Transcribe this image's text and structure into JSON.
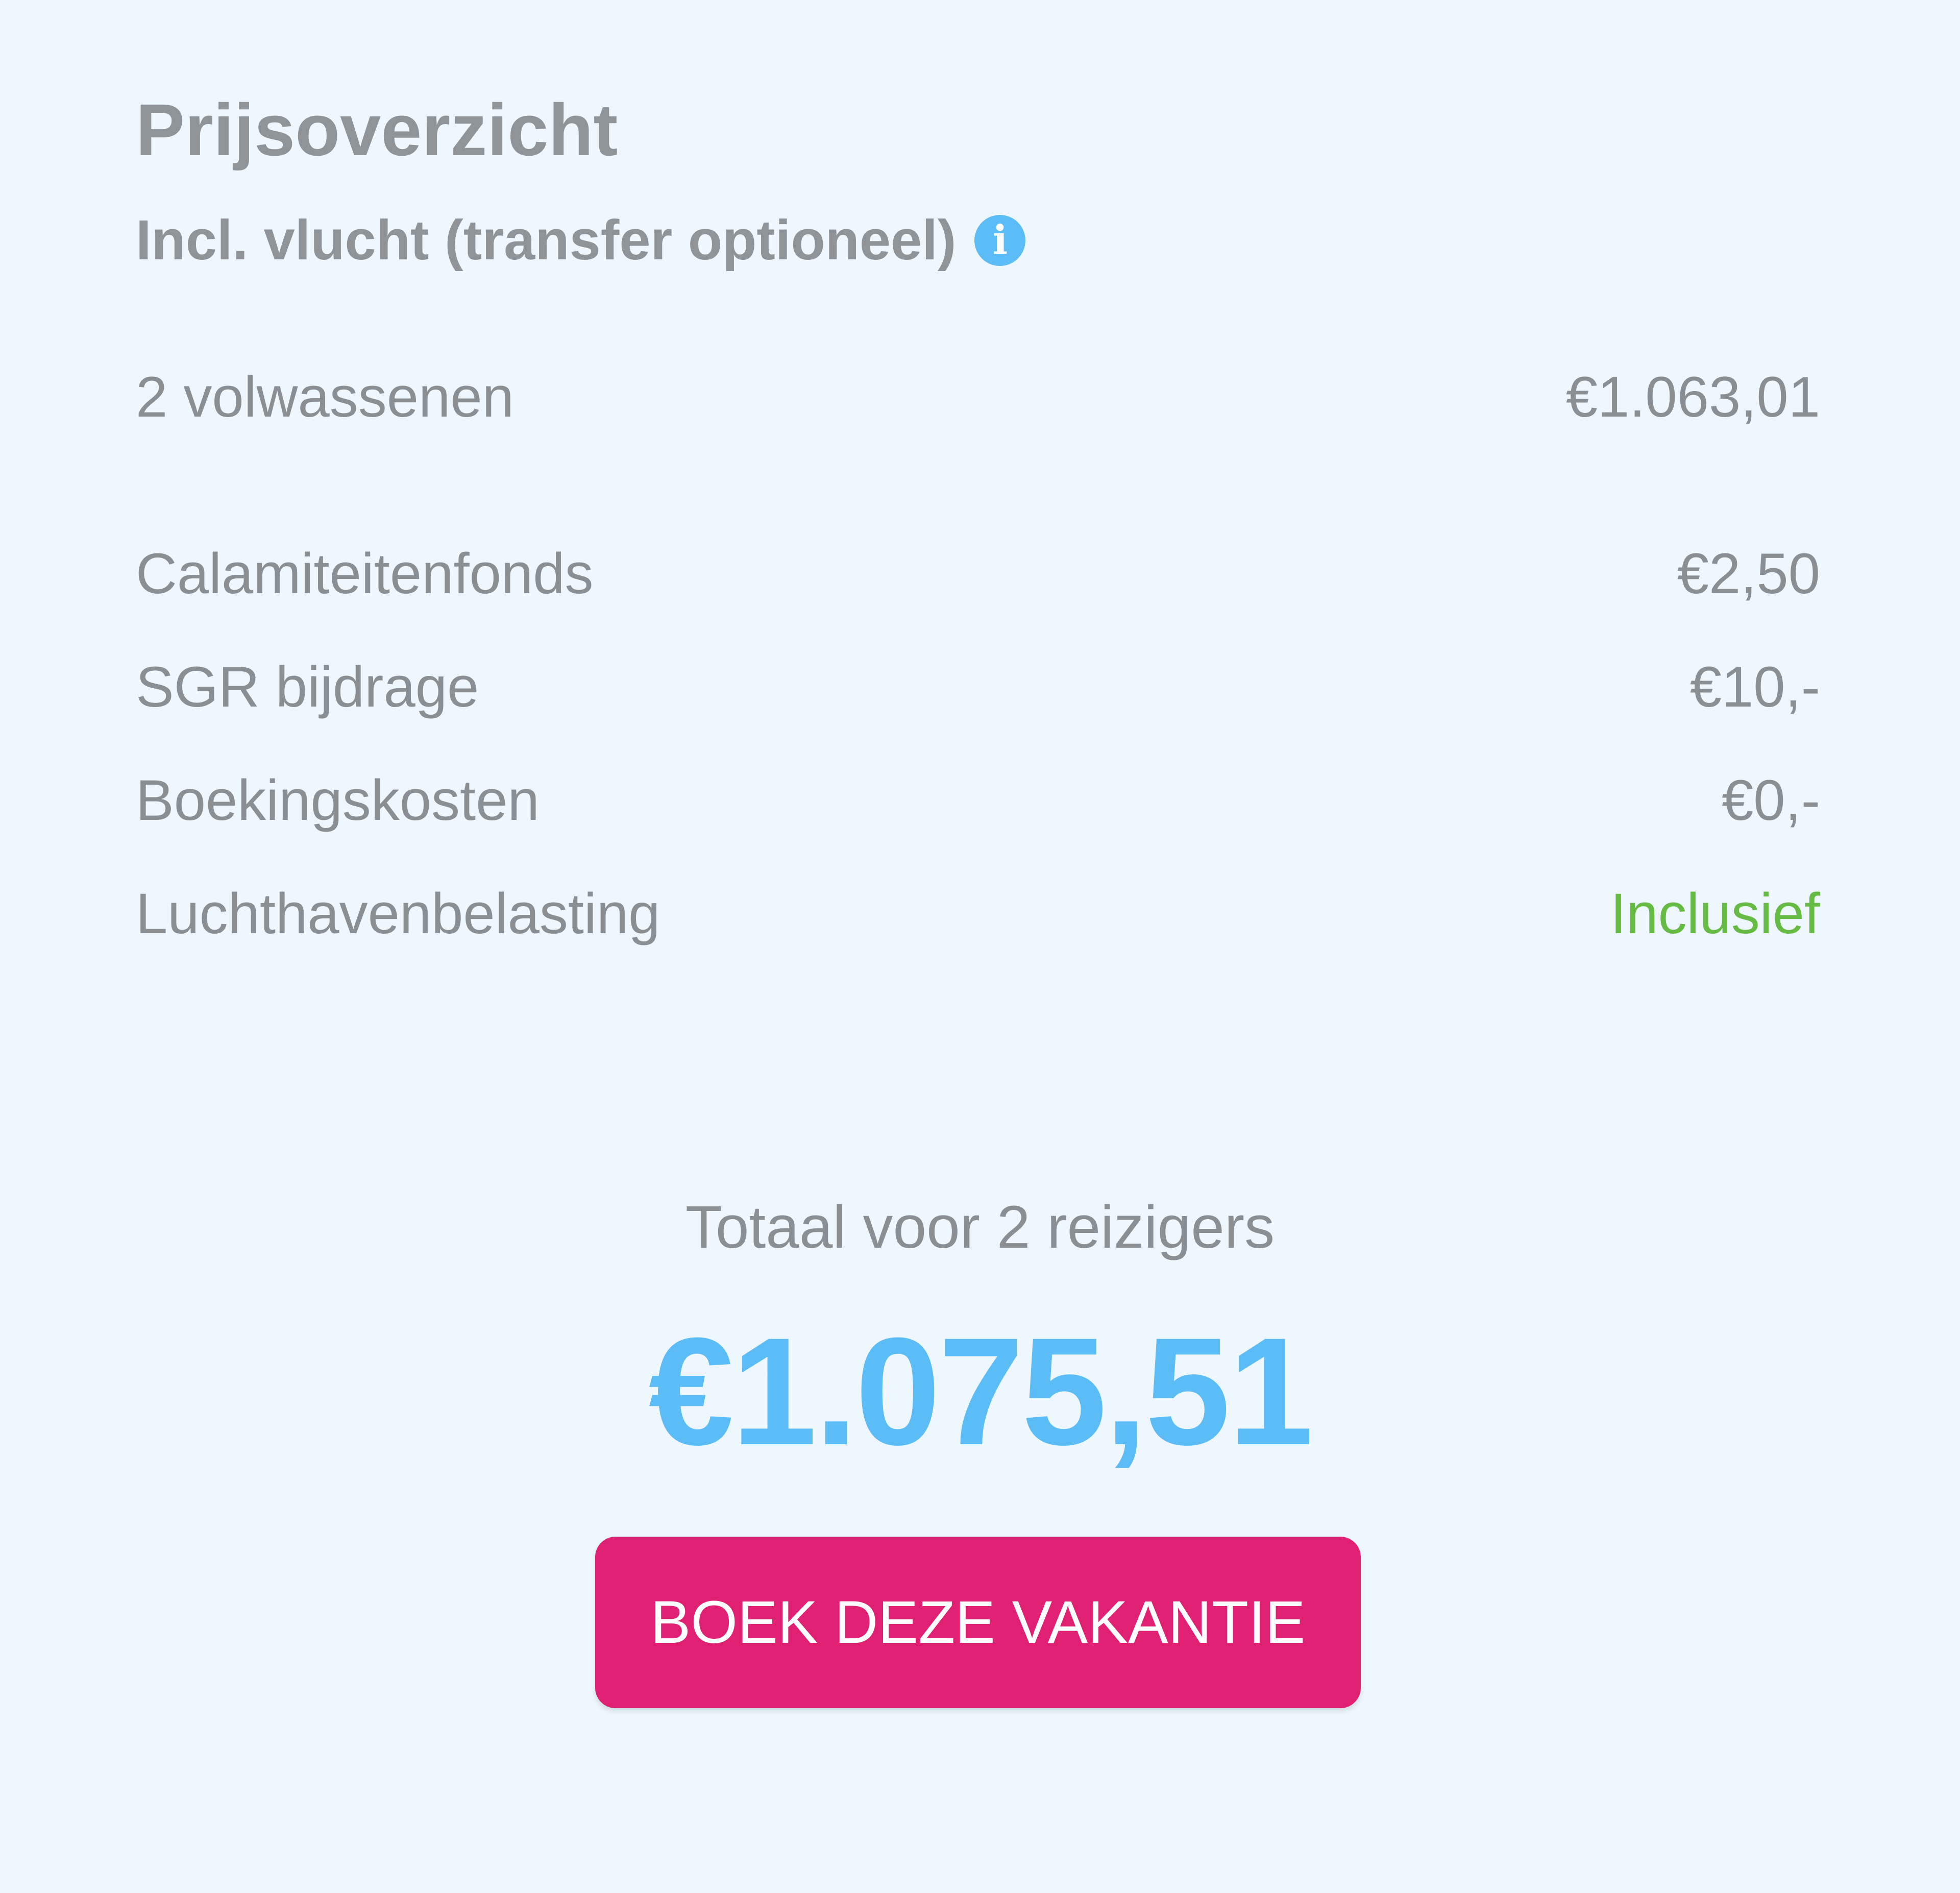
{
  "header": {
    "title": "Prijsoverzicht",
    "subtitle": "Incl. vlucht (transfer optioneel)",
    "info_icon_glyph": "i",
    "info_icon_name": "info-icon"
  },
  "price_lines": [
    {
      "label": "2 volwassenen",
      "value": "€1.063,01"
    },
    {
      "label": "Calamiteitenfonds",
      "value": "€2,50"
    },
    {
      "label": "SGR bijdrage",
      "value": "€10,-"
    },
    {
      "label": "Boekingskosten",
      "value": "€0,-"
    },
    {
      "label": "Luchthavenbelasting",
      "value": "Inclusief"
    }
  ],
  "total": {
    "label": "Totaal voor 2 reizigers",
    "amount": "€1.075,51"
  },
  "cta": {
    "label": "BOEK DEZE VAKANTIE"
  },
  "colors": {
    "background": "#eff7fe",
    "accent_blue": "#5cbcf5",
    "included_green": "#66bb44",
    "button_pink": "#e02173",
    "text_gray": "#8a8f94"
  }
}
